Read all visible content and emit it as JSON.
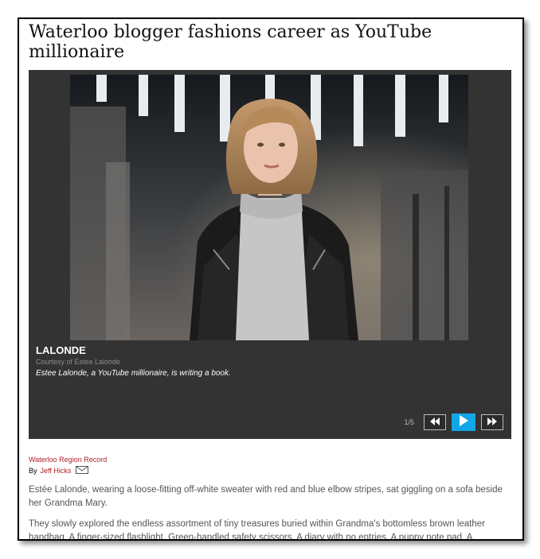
{
  "article": {
    "headline": "Waterloo blogger fashions career as YouTube millionaire",
    "source": "Waterloo Region Record",
    "by_label": "By",
    "author": "Jeff Hicks",
    "paragraphs": [
      "Estée Lalonde, wearing a loose-fitting off-white sweater with red and blue elbow stripes, sat giggling on a sofa beside her Grandma Mary.",
      "They slowly explored the endless assortment of tiny treasures buried within Grandma's bottomless brown leather handbag. A finger-sized flashlight. Green-handled safety scissors. A diary with no entries. A puppy note pad. A"
    ]
  },
  "gallery": {
    "caption_title": "LALONDE",
    "credit": "Courtesy of Estee Lalonde",
    "caption": "Estee Lalonde, a YouTube millionaire, is writing a book.",
    "counter": "1/5",
    "accent_color": "#11a6e6",
    "background_color": "#333333",
    "icons": {
      "prev": "rewind-icon",
      "play": "play-icon",
      "next": "fast-forward-icon",
      "email": "envelope-icon"
    }
  }
}
